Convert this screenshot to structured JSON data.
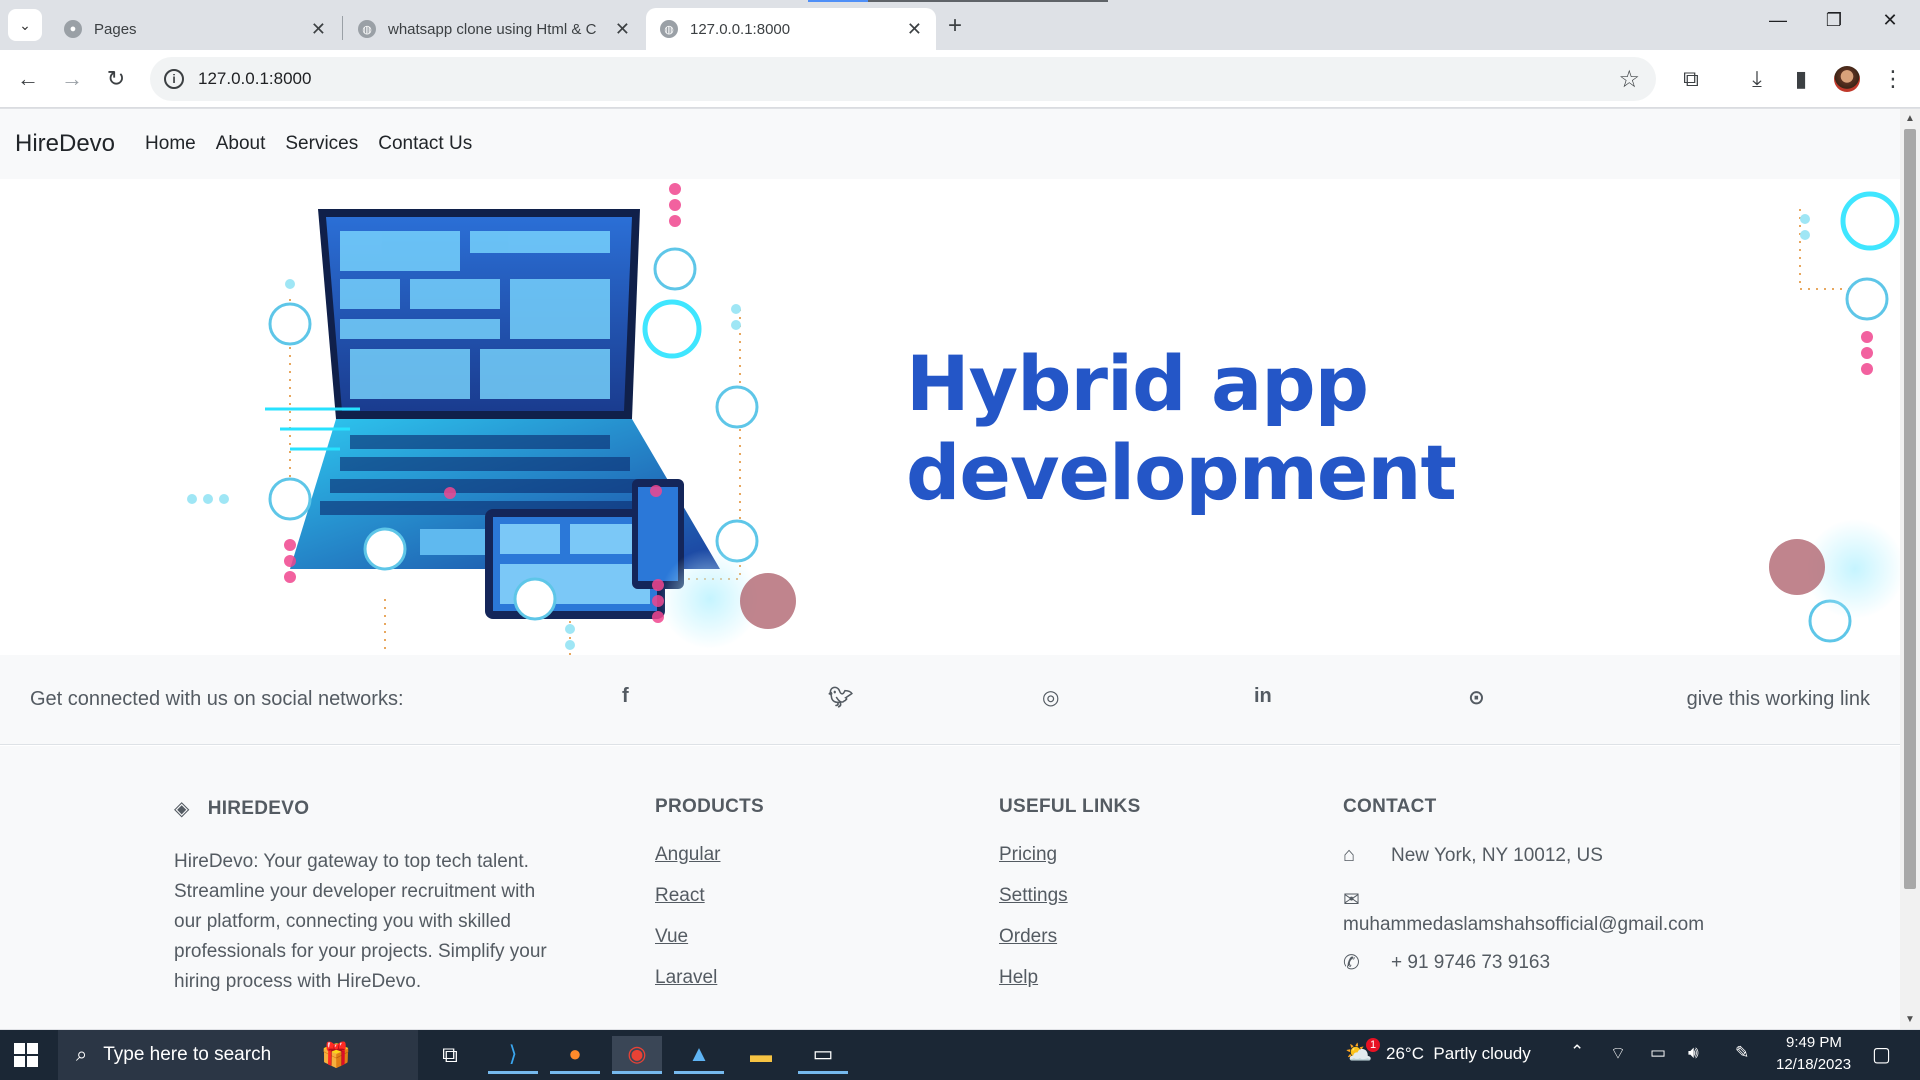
{
  "browser": {
    "tabs": [
      {
        "title": "Pages",
        "favicon": "github-icon"
      },
      {
        "title": "whatsapp clone using Html & C",
        "favicon": "globe-icon"
      },
      {
        "title": "127.0.0.1:8000",
        "favicon": "globe-icon"
      }
    ],
    "url": "127.0.0.1:8000"
  },
  "site": {
    "brand": "HireDevo",
    "nav": [
      "Home",
      "About",
      "Services",
      "Contact Us"
    ],
    "hero_title": "Hybrid app development",
    "social": {
      "text": "Get connected with us on social networks:",
      "icons": [
        "facebook-icon",
        "twitter-icon",
        "instagram-icon",
        "linkedin-icon",
        "github-icon"
      ],
      "right_text": "give this working link"
    },
    "footer": {
      "brand_heading": "HIREDEVO",
      "description": "HireDevo: Your gateway to top tech talent. Streamline your developer recruitment with our platform, connecting you with skilled professionals for your projects. Simplify your hiring process with HireDevo.",
      "products_heading": "PRODUCTS",
      "products": [
        "Angular",
        "React",
        "Vue",
        "Laravel"
      ],
      "links_heading": "USEFUL LINKS",
      "links": [
        "Pricing",
        "Settings",
        "Orders",
        "Help"
      ],
      "contact_heading": "CONTACT",
      "address": "New York, NY 10012, US",
      "email": "muhammedaslamshahsofficial@gmail.com",
      "phone": "+ 91 9746 73 9163"
    }
  },
  "taskbar": {
    "search_placeholder": "Type here to search",
    "weather": "26°C  Partly cloudy",
    "weather_badge": "1",
    "time": "9:49 PM",
    "date": "12/18/2023"
  },
  "colors": {
    "hero_title": "#2456c7",
    "taskbar": "#1b2735",
    "footer_bg": "#f8f9fa"
  }
}
